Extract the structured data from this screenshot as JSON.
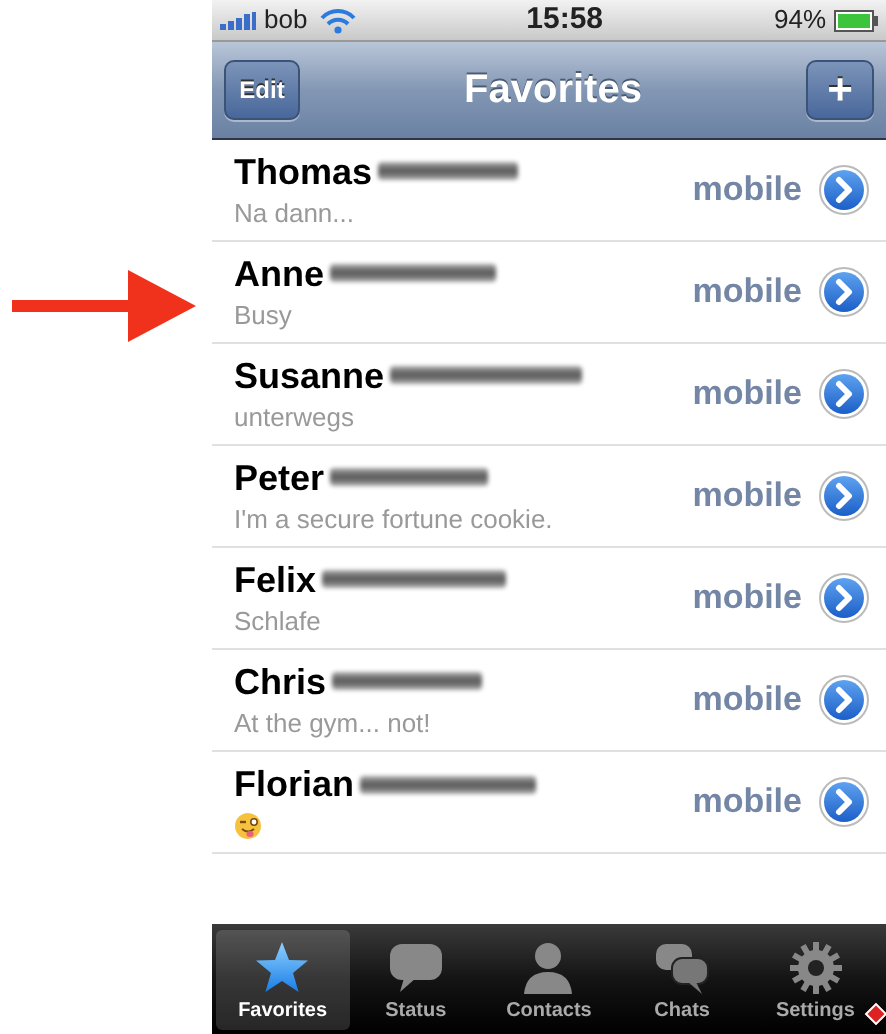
{
  "status_bar": {
    "carrier": "bob",
    "time": "15:58",
    "battery": "94%"
  },
  "nav_bar": {
    "left_button": "Edit",
    "title": "Favorites",
    "right_button": "+"
  },
  "contacts": [
    {
      "first_name": "Thomas",
      "status": "Na dann...",
      "phone_label": "mobile"
    },
    {
      "first_name": "Anne",
      "status": "Busy",
      "phone_label": "mobile",
      "highlighted_by_arrow": true
    },
    {
      "first_name": "Susanne",
      "status": "unterwegs",
      "phone_label": "mobile"
    },
    {
      "first_name": "Peter",
      "status": "I'm a secure fortune cookie.",
      "phone_label": "mobile"
    },
    {
      "first_name": "Felix",
      "status": "Schlafe",
      "phone_label": "mobile"
    },
    {
      "first_name": "Chris",
      "status": "At the gym... not!",
      "phone_label": "mobile"
    },
    {
      "first_name": "Florian",
      "status_emoji": true,
      "phone_label": "mobile"
    }
  ],
  "tab_bar": [
    {
      "label": "Favorites",
      "kind": "star",
      "selected": true,
      "badge": false
    },
    {
      "label": "Status",
      "kind": "bubble",
      "selected": false,
      "badge": false
    },
    {
      "label": "Contacts",
      "kind": "person",
      "selected": false,
      "badge": false
    },
    {
      "label": "Chats",
      "kind": "bubbles",
      "selected": false,
      "badge": false
    },
    {
      "label": "Settings",
      "kind": "gear",
      "selected": false,
      "badge": true
    }
  ]
}
